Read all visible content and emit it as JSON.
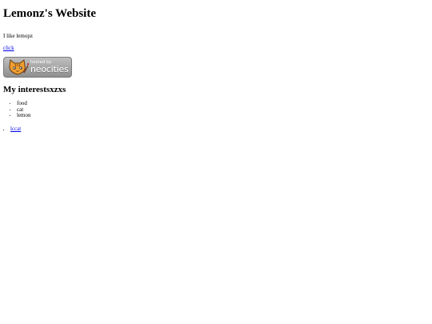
{
  "header": {
    "title": "Lemonz's Website",
    "tagline": "I like lemopz"
  },
  "links": {
    "click_label": "click"
  },
  "badge": {
    "icon": "neocities-cat-icon",
    "hosted_text": "hosted by",
    "brand_text": "neocities"
  },
  "interests": {
    "heading": "My interestsxzxs",
    "items": [
      "food",
      "cat",
      "lemon"
    ]
  },
  "extra_list": {
    "items": [
      {
        "label": "lccat"
      }
    ]
  }
}
